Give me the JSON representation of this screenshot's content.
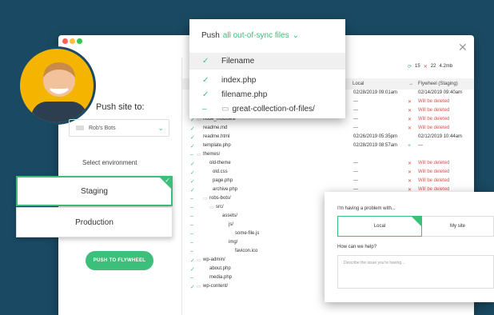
{
  "dropdown": {
    "prefix": "Push",
    "filter": "all out-of-sync files",
    "header": "Filename",
    "items": [
      {
        "label": "index.php",
        "state": "check"
      },
      {
        "label": "filename.php",
        "state": "check"
      },
      {
        "label": "great-collection-of-files/",
        "state": "partial"
      }
    ]
  },
  "left": {
    "push_title": "Push site to:",
    "site": "Rob's Bots",
    "env_label": "Select environment",
    "environments": [
      "Staging",
      "Production"
    ],
    "push_button": "PUSH TO FLYWHEEL"
  },
  "stats": {
    "sync": "15",
    "delete": "22",
    "size": "4.2mb"
  },
  "table": {
    "col_local": "Local",
    "col_remote": "Flywheel (Staging)",
    "rows": [
      {
        "name": "",
        "local": "02/28/2019 09:01am",
        "remote": "02/14/2019 09:40am",
        "status": "none"
      },
      {
        "name": "",
        "local": "---",
        "remote": "Will be deleted",
        "status": "del"
      },
      {
        "name": "",
        "local": "---",
        "remote": "Will be deleted",
        "status": "del"
      },
      {
        "name": "node_modules/",
        "local": "---",
        "remote": "Will be deleted",
        "status": "del"
      },
      {
        "name": "readme.md",
        "local": "---",
        "remote": "Will be deleted",
        "status": "del"
      },
      {
        "name": "readme.html",
        "local": "02/26/2019 05:35pm",
        "remote": "02/12/2019 10:44am",
        "status": "none"
      },
      {
        "name": "template.php",
        "local": "02/28/2019 08:57am",
        "remote": "---",
        "status": "add"
      },
      {
        "name": "themes/",
        "local": "",
        "remote": "",
        "status": "none"
      },
      {
        "name": "old-theme",
        "local": "---",
        "remote": "Will be deleted",
        "status": "del"
      },
      {
        "name": "old.css",
        "local": "---",
        "remote": "Will be deleted",
        "status": "del"
      },
      {
        "name": "page.php",
        "local": "---",
        "remote": "Will be deleted",
        "status": "del"
      },
      {
        "name": "archive.php",
        "local": "---",
        "remote": "Will be deleted",
        "status": "del"
      },
      {
        "name": "robs-bots/",
        "local": "",
        "remote": "",
        "status": "none"
      },
      {
        "name": "src/",
        "local": "",
        "remote": "",
        "status": "none"
      },
      {
        "name": "assets/",
        "local": "",
        "remote": "",
        "status": "none"
      },
      {
        "name": "js/",
        "local": "",
        "remote": "",
        "status": "none"
      },
      {
        "name": "some-file.js",
        "local": "",
        "remote": "",
        "status": "none"
      },
      {
        "name": "img/",
        "local": "",
        "remote": "",
        "status": "none"
      },
      {
        "name": "favicon.ico",
        "local": "",
        "remote": "",
        "status": "none"
      },
      {
        "name": "wp-admin/",
        "local": "",
        "remote": "",
        "status": "none"
      },
      {
        "name": "about.php",
        "local": "",
        "remote": "",
        "status": "none"
      },
      {
        "name": "media.php",
        "local": "",
        "remote": "",
        "status": "none"
      },
      {
        "name": "wp-content/",
        "local": "",
        "remote": "",
        "status": "none"
      }
    ]
  },
  "help": {
    "question": "I'm having a problem with...",
    "options": [
      "Local",
      "My site"
    ],
    "question2": "How can we help?",
    "placeholder": "Describe the issue you're having..."
  },
  "colors": {
    "accent": "#3bbf7a",
    "danger": "#e05050",
    "background": "#1a4a63"
  }
}
